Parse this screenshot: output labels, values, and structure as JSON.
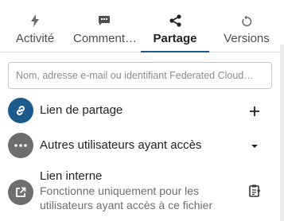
{
  "tabs": [
    {
      "label": "Activité",
      "icon": "lightning-icon",
      "active": false
    },
    {
      "label": "Comment…",
      "icon": "comment-icon",
      "active": false
    },
    {
      "label": "Partage",
      "icon": "share-icon",
      "active": true
    },
    {
      "label": "Versions",
      "icon": "history-icon",
      "active": false
    }
  ],
  "search": {
    "placeholder": "Nom, adresse e-mail ou identifiant Federated Cloud…"
  },
  "share_link": {
    "title": "Lien de partage",
    "icon": "link-icon",
    "action_icon": "plus-icon"
  },
  "others_with_access": {
    "title": "Autres utilisateurs ayant accès",
    "icon": "dots-icon",
    "action_icon": "chevron-down-icon"
  },
  "internal_link": {
    "title": "Lien interne",
    "subtitle": "Fonctionne uniquement pour les utilisateurs ayant accès à ce fichier",
    "icon": "open-in-new-icon",
    "action_icon": "clipboard-icon"
  },
  "colors": {
    "accent": "#1d5a8c",
    "neutral_avatar": "#6e6e6e"
  }
}
